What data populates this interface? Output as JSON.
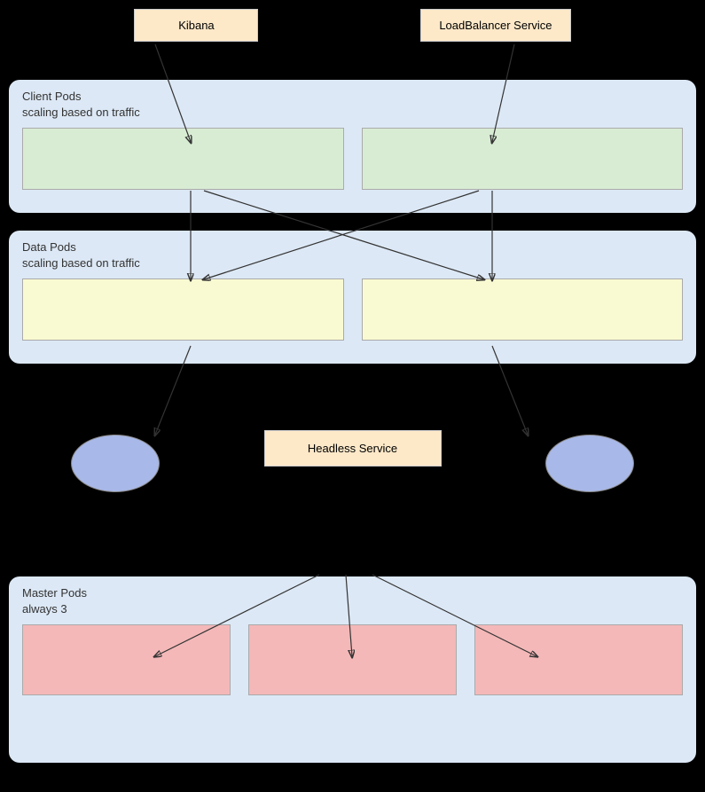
{
  "top": {
    "kibana_label": "Kibana",
    "loadbalancer_label": "LoadBalancer Service"
  },
  "client_pods": {
    "label_line1": "Client Pods",
    "label_line2": "scaling based on traffic"
  },
  "data_pods": {
    "label_line1": "Data Pods",
    "label_line2": "scaling based on traffic"
  },
  "headless": {
    "label": "Headless Service"
  },
  "master_pods": {
    "label_line1": "Master Pods",
    "label_line2": "always 3"
  }
}
